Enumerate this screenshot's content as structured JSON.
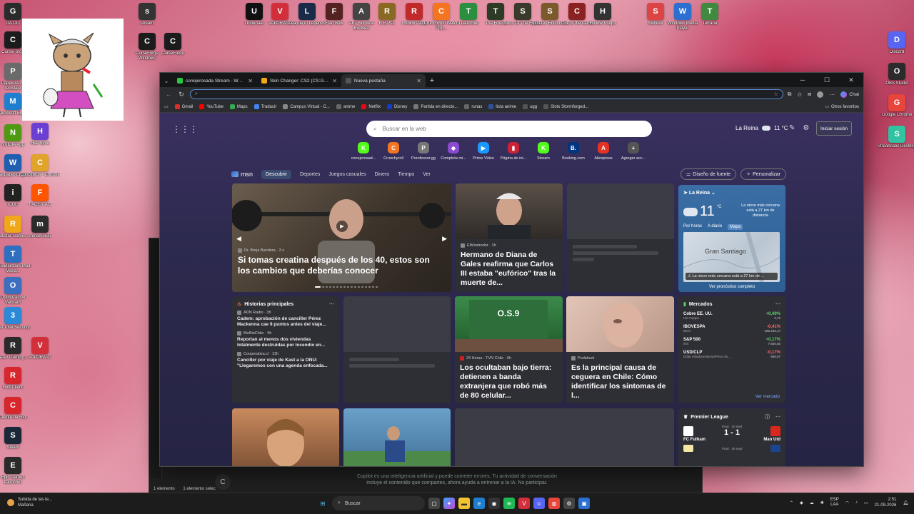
{
  "desktop": {
    "left_icons": [
      {
        "label": "GA OLI",
        "color": "#2b2b2b"
      },
      {
        "label": "CurseForge",
        "color": "#1c1c1c"
      },
      {
        "label": "Papelera de reciclaje",
        "color": "#6a6a6a"
      },
      {
        "label": "Microsoft Edge",
        "color": "#1f7fcf"
      },
      {
        "label": "NVIDIA App",
        "color": "#4f9a12"
      },
      {
        "label": "Wallpaper Engine",
        "color": "#1f5fb0"
      },
      {
        "label": "iCUE",
        "color": "#222"
      },
      {
        "label": "Rockstar Games ...",
        "color": "#f0a81a"
      },
      {
        "label": "Thunderstore Mod Mana...",
        "color": "#2f6fbf"
      },
      {
        "label": "Optimización Valorant",
        "color": "#3c6fc0"
      },
      {
        "label": "360 Total Security",
        "color": "#2a8ad8"
      },
      {
        "label": "Razer Gaming ...",
        "color": "#2b2b2b"
      },
      {
        "label": "Riot Client",
        "color": "#d7272d"
      },
      {
        "label": "Cliente de Riot",
        "color": "#d7272d"
      },
      {
        "label": "Steam",
        "color": "#1b2838"
      },
      {
        "label": "Epic Games Launcher",
        "color": "#2a2a2a"
      }
    ],
    "left_icons_col2": [
      {
        "label": "Hue Sync",
        "color": "#6a3fd1"
      },
      {
        "label": "Conceptos - Chrome",
        "color": "#e0a42a"
      },
      {
        "label": "FACEIT AC",
        "color": "#ff5500"
      },
      {
        "label": "mmamenai",
        "color": "#2b2b2b"
      },
      {
        "label": "VALORANT",
        "color": "#d32f3a"
      }
    ],
    "top_icons": [
      {
        "label": "stream",
        "color": "#333"
      },
      {
        "label": "CurseForge Windows",
        "color": "#1c1c1c"
      },
      {
        "label": "CurseForge",
        "color": "#1c1c1c"
      },
      {
        "label": "Undertale",
        "color": "#111"
      },
      {
        "label": "VALORANT",
        "color": "#d32f3a"
      },
      {
        "label": "League of Legends",
        "color": "#1a2b4a"
      },
      {
        "label": "Fran Bow",
        "color": "#552222"
      },
      {
        "label": "AKT Survival Evolved",
        "color": "#444"
      },
      {
        "label": "R.E.P.O.",
        "color": "#8a6a22"
      },
      {
        "label": "Roblox Party",
        "color": "#c02a2a"
      },
      {
        "label": "Crunchyroll Watch Pop...",
        "color": "#f47521"
      },
      {
        "label": "TLauncher",
        "color": "#2c8f3f"
      },
      {
        "label": "The Forest",
        "color": "#2d3a25"
      },
      {
        "label": "Sons Of The Forest",
        "color": "#3a3a2a"
      },
      {
        "label": "Spintires Edición F...",
        "color": "#7a5a2a"
      },
      {
        "label": "Cult of the Lamb",
        "color": "#8a2222"
      },
      {
        "label": "Hollow Knight",
        "color": "#333"
      },
      {
        "label": "Skindex",
        "color": "#d44"
      },
      {
        "label": "Windows Media Player",
        "color": "#2d6fd1"
      },
      {
        "label": "Terraria",
        "color": "#3f8a3f"
      }
    ],
    "right_icons": [
      {
        "label": "Discord",
        "color": "#5865f2"
      },
      {
        "label": "OBS Studio",
        "color": "#2b2b2b"
      },
      {
        "label": "Google Chrome",
        "color": "#e8453c"
      },
      {
        "label": "Streamlabs Desktop",
        "color": "#31c3a2"
      }
    ]
  },
  "explorer": {
    "status_items": "1 elemento",
    "status_selected": "1 elemento selec"
  },
  "copilot": {
    "line1": "Copilot es una inteligencia artificial y puede cometer errores. Tu actividad de conversación",
    "line2": "incluye el contenido que compartes, ahora ayuda a entrenar a la IA. No participar.",
    "button": "C"
  },
  "browser": {
    "tabs": [
      {
        "title": "conejerosada Stream - Watch Liv...",
        "color": "#2ac93c"
      },
      {
        "title": "Skin Changer: CS2 (CS:GO) Trading...",
        "color": "#f0a81a"
      },
      {
        "title": "Nueva pestaña",
        "color": "#555"
      }
    ],
    "address_value": "",
    "chat_label": "Chat",
    "bookmarks": [
      {
        "label": "Gmail",
        "color": "#d93025"
      },
      {
        "label": "YouTube",
        "color": "#ff0000"
      },
      {
        "label": "Maps",
        "color": "#34a853"
      },
      {
        "label": "Traducir",
        "color": "#4285f4"
      },
      {
        "label": "Campus Virtual - C...",
        "color": "#888"
      },
      {
        "label": "anime",
        "color": "#666"
      },
      {
        "label": "Netflix",
        "color": "#e50914"
      },
      {
        "label": "Disney",
        "color": "#113ccf"
      },
      {
        "label": "Partida en directo...",
        "color": "#777"
      },
      {
        "label": "runas",
        "color": "#666"
      },
      {
        "label": "lista anime",
        "color": "#2e51a2"
      },
      {
        "label": "ugg",
        "color": "#555"
      },
      {
        "label": "Slots Stormforged...",
        "color": "#555"
      }
    ],
    "other_favs": "Otros favoritos"
  },
  "ntp": {
    "search_placeholder": "Buscar en la web",
    "location": "La Reina",
    "temp": "11 °C",
    "login": "Iniciar sesión",
    "quicklinks": [
      {
        "label": "conejerosad...",
        "icon": "K",
        "color": "#53fc18"
      },
      {
        "label": "Crunchyroll",
        "icon": "C",
        "color": "#f47521"
      },
      {
        "label": "Porofessor.gg",
        "icon": "P",
        "color": "#777"
      },
      {
        "label": "Completa mi...",
        "icon": "◆",
        "color": "#8a4bd1"
      },
      {
        "label": "Prime Video",
        "icon": "▶",
        "color": "#1a98ff"
      },
      {
        "label": "Página de ini...",
        "icon": "▮",
        "color": "#c23"
      },
      {
        "label": "Stream",
        "icon": "K",
        "color": "#53fc18"
      },
      {
        "label": "Booking.com",
        "icon": "B.",
        "color": "#003580"
      },
      {
        "label": "Aliexpress",
        "icon": "A",
        "color": "#e43225"
      },
      {
        "label": "Agregar acc...",
        "icon": "+",
        "color": "#555"
      }
    ]
  },
  "msn": {
    "logo": "msn",
    "tabs": [
      "Descubrir",
      "Deportes",
      "Juegos casuales",
      "Dinero",
      "Tiempo",
      "Ver"
    ],
    "font_btn": "Diseño de fuente",
    "custom_btn": "Personalizar",
    "hero": {
      "source": "Dr. Borja Bandera · 3 s",
      "title": "Si tomas creatina después de los 40, estos son los cambios que deberías conocer"
    },
    "card2": {
      "source": "ElMostrador · 1h",
      "title": "Hermano de Diana de Gales reafirma que Carlos III estaba \"eufórico\" tras la muerte de..."
    },
    "weather": {
      "location": "La Reina",
      "temp": "11",
      "unit": "°C",
      "snow": "La nieve más cercana está a 27 km de distancia",
      "tabs": [
        "Por horas",
        "A diario",
        "Mapa"
      ],
      "city": "Gran Santiago",
      "alert": "La nieve más cercana está a 27 km de ...",
      "more": "Ver pronóstico completo"
    },
    "top_stories": {
      "title": "Historias principales",
      "items": [
        {
          "source": "ADN Radio · 3h",
          "title": "Cadem: aprobación de canciller Pérez Mackenna cae 9 puntos antes del viaje..."
        },
        {
          "source": "BioBioChile · 5h",
          "title": "Reportan al menos dos viviendas totalmente destruidas por incendio en..."
        },
        {
          "source": "Cooperativa.cl · 13h",
          "title": "Canciller por viaje de Kast a la ONU: \"Llegaremos con una agenda enfocada..."
        }
      ]
    },
    "card_osb": {
      "source": "24 Horas - TVN Chile · 6h",
      "title": "Los ocultaban bajo tierra: detienen a banda extranjera que robó más de 80 celular..."
    },
    "card_eye": {
      "source": "Pudahuel",
      "title": "Es la principal causa de ceguera en Chile: Cómo identificar los síntomas de l..."
    },
    "markets": {
      "title": "Mercados",
      "rows": [
        {
          "name": "Cobre EE. UU.",
          "sub": "US Copper",
          "change": "+0,49%",
          "price": "4,72",
          "dir": "pos"
        },
        {
          "name": "IBOVESPA",
          "sub": "IBOV",
          "change": "-0,41%",
          "price": "185.229,17",
          "dir": "neg"
        },
        {
          "name": "S&P 500",
          "sub": "INX",
          "change": "+0,17%",
          "price": "7.650,50",
          "dir": "pos"
        },
        {
          "name": "USD/CLP",
          "sub": "Dólar estadounidense/Peso chi...",
          "change": "-0,17%",
          "price": "958,97",
          "dir": "neg"
        }
      ],
      "more": "Ver mercado"
    },
    "league": {
      "title": "Premier League",
      "match1": {
        "status": "Final · 20 sept",
        "home": "FC Fulham",
        "score": "1 - 1",
        "away": "Man Utd"
      },
      "match2": {
        "status": "Final · 20 sept"
      }
    }
  },
  "taskbar": {
    "weather_line1": "Subida de las te...",
    "weather_line2": "Mañana",
    "search_label": "Buscar",
    "lang1": "ESP",
    "lang2": "LAA",
    "time": "2:51",
    "date": "21-09-2026"
  }
}
